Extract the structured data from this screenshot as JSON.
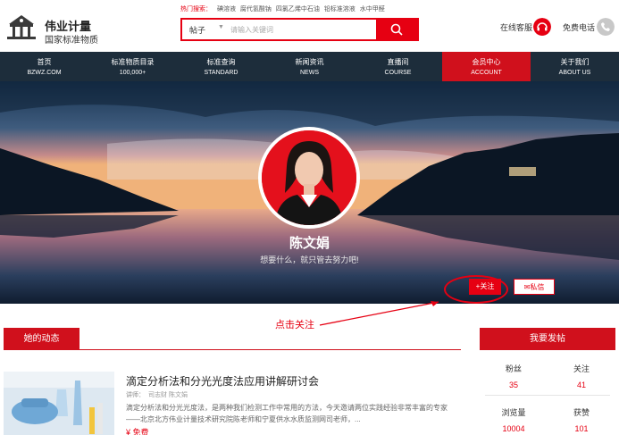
{
  "brand": {
    "name": "伟业计量",
    "sub": "国家标准物质"
  },
  "hot_search": {
    "label": "热门搜索：",
    "keywords": [
      "碘溶液",
      "腐代氢酸钠",
      "四氯乙烯中石油",
      "铅标准溶液",
      "水中甲醛"
    ]
  },
  "search": {
    "category": "帖子",
    "placeholder": "请输入关键词"
  },
  "header_links": {
    "online_service": "在线客服",
    "free_phone": "免费电话"
  },
  "nav": [
    {
      "title": "首页",
      "sub": "BZWZ.COM"
    },
    {
      "title": "标准物质目录",
      "sub": "100,000+"
    },
    {
      "title": "标准查询",
      "sub": "STANDARD"
    },
    {
      "title": "新闻资讯",
      "sub": "NEWS"
    },
    {
      "title": "直播间",
      "sub": "COURSE"
    },
    {
      "title": "会员中心",
      "sub": "ACCOUNT"
    },
    {
      "title": "关于我们",
      "sub": "ABOUT US"
    }
  ],
  "nav_active_index": 5,
  "profile": {
    "name": "陈文娟",
    "motto": "想要什么，就只管去努力吧!",
    "follow": "+关注",
    "message": "私信"
  },
  "annotation": "点击关注",
  "sections": {
    "feed": "她的动态",
    "side": "我要发帖"
  },
  "post": {
    "title": "滴定分析法和分光光度法应用讲解研讨会",
    "meta_label": "讲师：",
    "meta_value": "司志财 陈文娟",
    "desc": "滴定分析法和分光光度法，是两种我们检测工作中常用的方法，今天邀请两位实践经验非常丰富的专家——北京北方伟业计量技术研究院陈老师和宁夏供水水质监测网司老师，...",
    "price": "¥ 免费"
  },
  "stats": [
    {
      "label": "粉丝",
      "value": "35"
    },
    {
      "label": "关注",
      "value": "41"
    },
    {
      "label": "浏览量",
      "value": "10004"
    },
    {
      "label": "获赞",
      "value": "101"
    }
  ],
  "colors": {
    "brand_red": "#e60012",
    "nav_bg": "#1d2d3b",
    "nav_active": "#d0101c"
  }
}
